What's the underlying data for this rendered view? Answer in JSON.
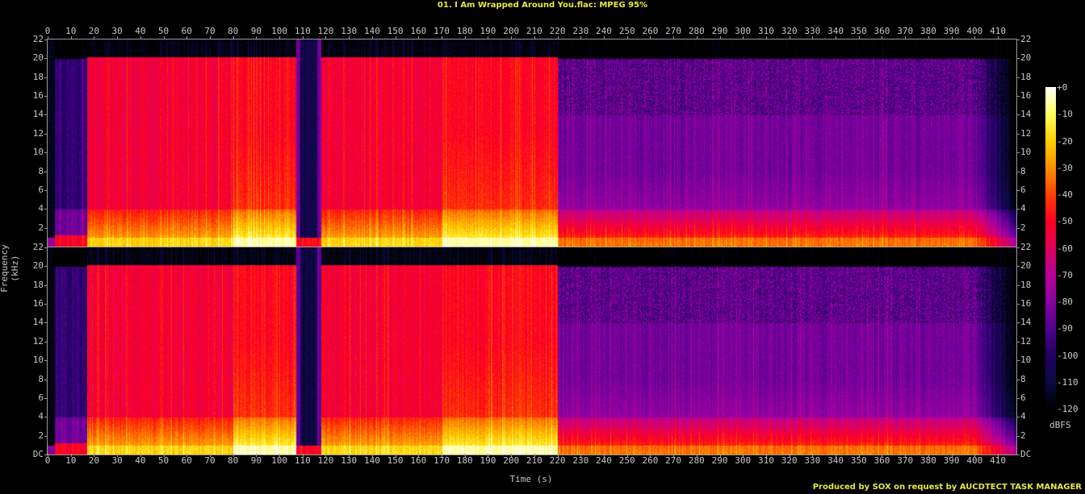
{
  "title": "01. I Am Wrapped Around You.flac: MPEG 95%",
  "footer": "Produced by SOX on request by AUCDTECT TASK MANAGER",
  "chart_data": {
    "type": "heatmap",
    "title": "01. I Am Wrapped Around You.flac: MPEG 95%",
    "xlabel": "Time (s)",
    "ylabel": "Frequency (kHz)",
    "xlim": [
      0,
      418
    ],
    "ylim": [
      0,
      22
    ],
    "zlim": [
      -120,
      0
    ],
    "zlabel": "dBFS",
    "channels": 2,
    "x_ticks": [
      "0",
      "10",
      "20",
      "30",
      "40",
      "50",
      "60",
      "70",
      "80",
      "90",
      "100",
      "110",
      "120",
      "130",
      "140",
      "150",
      "160",
      "170",
      "180",
      "190",
      "200",
      "210",
      "220",
      "230",
      "240",
      "250",
      "260",
      "270",
      "280",
      "290",
      "300",
      "310",
      "320",
      "330",
      "340",
      "350",
      "360",
      "370",
      "380",
      "390",
      "400",
      "410"
    ],
    "y_ticks": [
      "DC",
      "2",
      "4",
      "6",
      "8",
      "10",
      "12",
      "14",
      "16",
      "18",
      "20",
      "22"
    ],
    "z_ticks": [
      "+0",
      "-10",
      "-20",
      "-30",
      "-40",
      "-50",
      "-60",
      "-70",
      "-80",
      "-90",
      "-100",
      "-110",
      "-120"
    ],
    "colormap": [
      "#000000",
      "#0a0a40",
      "#200060",
      "#500090",
      "#8a00a0",
      "#b8009a",
      "#e0005a",
      "#ff0020",
      "#ff4000",
      "#ff9000",
      "#ffd000",
      "#ffff60",
      "#ffffff"
    ],
    "segments": [
      {
        "t": [
          0,
          3
        ],
        "cutoff_khz": 0,
        "level_db": -115
      },
      {
        "t": [
          3,
          17
        ],
        "cutoff_khz": 20,
        "level_db": -95
      },
      {
        "t": [
          17,
          80
        ],
        "cutoff_khz": 20.2,
        "level_db": -52
      },
      {
        "t": [
          80,
          107
        ],
        "cutoff_khz": 20.2,
        "level_db": -45
      },
      {
        "t": [
          107,
          118
        ],
        "cutoff_khz": 1,
        "level_db": -110
      },
      {
        "t": [
          118,
          170
        ],
        "cutoff_khz": 20.2,
        "level_db": -52
      },
      {
        "t": [
          170,
          220
        ],
        "cutoff_khz": 20.2,
        "level_db": -45
      },
      {
        "t": [
          220,
          400
        ],
        "cutoff_khz": 20,
        "level_db": -82
      },
      {
        "t": [
          400,
          418
        ],
        "cutoff_khz": 20,
        "level_db": -100
      }
    ]
  }
}
